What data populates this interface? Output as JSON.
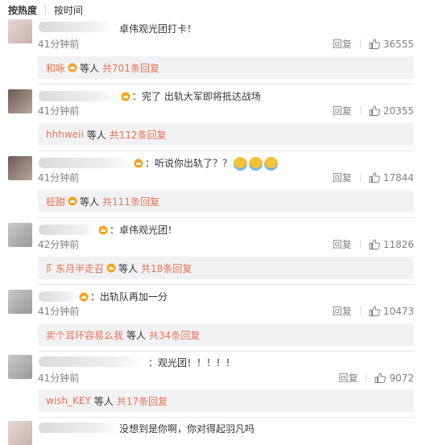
{
  "tabs": {
    "hot": "按热度",
    "time": "按时间"
  },
  "actions": {
    "reply": "回复"
  },
  "summary_parts": {
    "etc": "等人",
    "count_prefix": "共",
    "count_suffix": "条回复"
  },
  "comments": [
    {
      "text": "卓伟观光团打卡！",
      "time": "41分钟前",
      "likes": "36555",
      "reply_user": "和咏",
      "reply_count": "701"
    },
    {
      "text": "：完了 出轨大军即将抵达战场",
      "time": "41分钟前",
      "likes": "20355",
      "reply_user": "hhhweii",
      "reply_count": "112"
    },
    {
      "text": "：听说你出轨了？？",
      "time": "41分钟前",
      "likes": "17844",
      "reply_user": "柾甜",
      "reply_count": "111"
    },
    {
      "text": "：卓伟观光团！",
      "time": "42分钟前",
      "likes": "11826",
      "reply_user": "阝东月半走召",
      "reply_count": "18"
    },
    {
      "text": "：出轨队再加一分",
      "time": "41分钟前",
      "likes": "10473",
      "reply_user": "卖个耳环容易么我",
      "reply_count": "34"
    },
    {
      "text": "：观光团！！！！！",
      "time": "41分钟前",
      "likes": "9072",
      "reply_user": "wish_KEY",
      "reply_count": "17"
    },
    {
      "text": "没想到是你啊，你对得起羽凡吗"
    }
  ],
  "icons": {
    "vip_badge": "orange-crown-badge",
    "like": "thumbs-up-icon",
    "emoji": "hug-emoji"
  },
  "colors": {
    "accent": "#eb7350",
    "summary_bg": "#f2f2f5",
    "muted": "#808080"
  }
}
